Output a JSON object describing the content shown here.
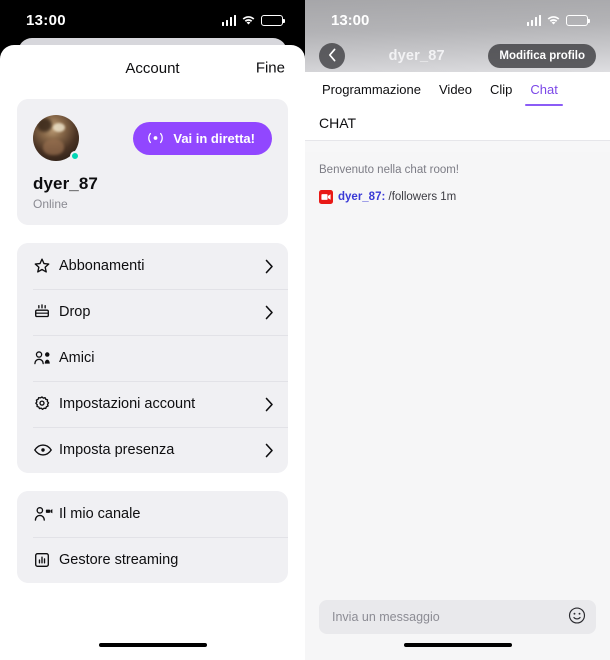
{
  "left_phone": {
    "status_bar": {
      "time": "13:00",
      "signal_icon": "cellular-bars-icon",
      "wifi_icon": "wifi-icon",
      "battery_icon": "battery-icon"
    },
    "sheet": {
      "title": "Account",
      "done_label": "Fine"
    },
    "profile": {
      "avatar_name": "avatar",
      "username": "dyer_87",
      "status": "Online",
      "online_indicator": "online-dot",
      "live_button_label": "Vai in diretta!",
      "live_button_icon": "broadcast-icon",
      "live_button_color": "#9147ff"
    },
    "menu_group_1": [
      {
        "label": "Abbonamenti",
        "icon": "star-icon",
        "chevron": true
      },
      {
        "label": "Drop",
        "icon": "drop-gift-icon",
        "chevron": true
      },
      {
        "label": "Amici",
        "icon": "friends-icon",
        "chevron": false
      },
      {
        "label": "Impostazioni account",
        "icon": "gear-icon",
        "chevron": true
      },
      {
        "label": "Imposta presenza",
        "icon": "eye-icon",
        "chevron": true
      }
    ],
    "menu_group_2": [
      {
        "label": "Il mio canale",
        "icon": "person-video-icon",
        "chevron": false
      },
      {
        "label": "Gestore streaming",
        "icon": "bar-chart-box-icon",
        "chevron": false
      }
    ]
  },
  "right_phone": {
    "status_bar": {
      "time": "13:00",
      "signal_icon": "cellular-bars-icon",
      "wifi_icon": "wifi-icon",
      "battery_icon": "battery-icon"
    },
    "nav": {
      "back_icon": "chevron-left-icon",
      "title": "dyer_87",
      "edit_profile_label": "Modifica profilo"
    },
    "tabs": [
      {
        "label": "Programmazione",
        "active": false
      },
      {
        "label": "Video",
        "active": false
      },
      {
        "label": "Clip",
        "active": false
      },
      {
        "label": "Chat",
        "active": true
      }
    ],
    "tab_accent_color": "#8b5cf6",
    "chat": {
      "section_title": "CHAT",
      "welcome": "Benvenuto nella chat room!",
      "messages": [
        {
          "badge_icon": "broadcaster-badge-icon",
          "badge_color": "#e91916",
          "user": "dyer_87:",
          "text": " /followers 1m"
        }
      ]
    },
    "composer": {
      "placeholder": "Invia un messaggio",
      "value": "",
      "emoji_icon": "emoji-smiley-icon"
    }
  }
}
